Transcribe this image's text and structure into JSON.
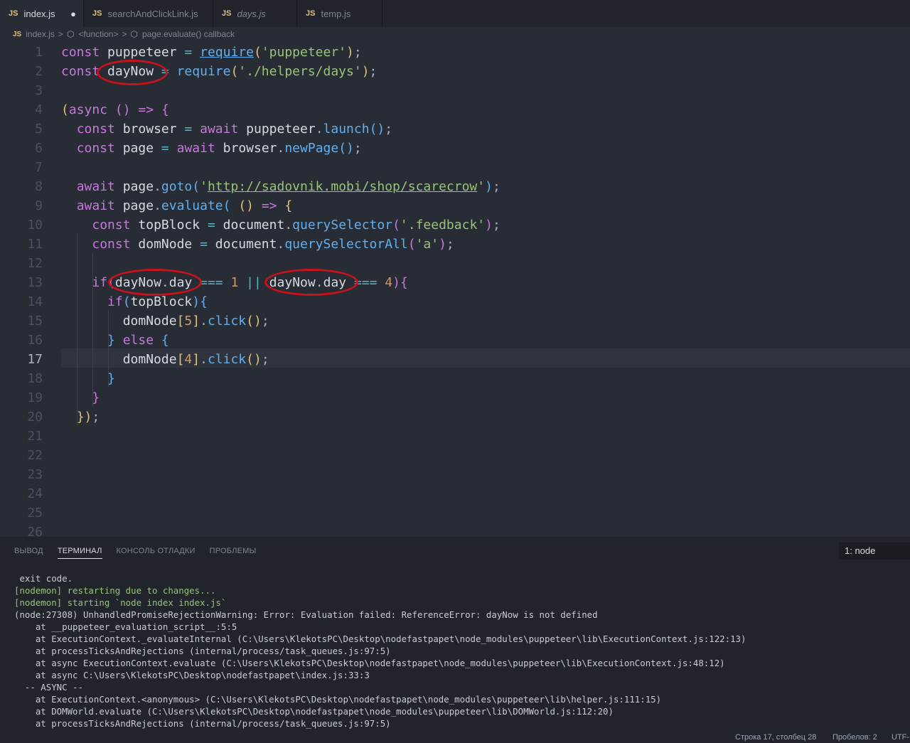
{
  "tabs": [
    {
      "label": "index.js",
      "badge": "JS",
      "modified": true
    },
    {
      "label": "searchAndClickLink.js",
      "badge": "JS"
    },
    {
      "label": "days.js",
      "badge": "JS",
      "italic": true
    },
    {
      "label": "temp.js",
      "badge": "JS"
    }
  ],
  "breadcrumb": {
    "file": "index.js",
    "badge": "JS",
    "fn": "<function>",
    "callback": "page.evaluate() callback",
    "separator": ">"
  },
  "editor": {
    "line_numbers": [
      "1",
      "2",
      "3",
      "4",
      "5",
      "6",
      "7",
      "8",
      "9",
      "10",
      "11",
      "12",
      "13",
      "14",
      "15",
      "16",
      "17",
      "18",
      "19",
      "20",
      "21",
      "22",
      "23",
      "24",
      "25",
      "26"
    ],
    "current_line": 17
  },
  "panel": {
    "tabs": [
      "ВЫВОД",
      "ТЕРМИНАЛ",
      "КОНСОЛЬ ОТЛАДКИ",
      "ПРОБЛЕМЫ"
    ],
    "active_tab": "ТЕРМИНАЛ",
    "terminal_select": "1: node",
    "terminal_lines": [
      " exit code.",
      "[nodemon] restarting due to changes...",
      "[nodemon] starting `node index index.js`",
      "(node:27308) UnhandledPromiseRejectionWarning: Error: Evaluation failed: ReferenceError: dayNow is not defined",
      "    at __puppeteer_evaluation_script__:5:5",
      "    at ExecutionContext._evaluateInternal (C:\\Users\\KlekotsPC\\Desktop\\nodefastpapet\\node_modules\\puppeteer\\lib\\ExecutionContext.js:122:13)",
      "    at processTicksAndRejections (internal/process/task_queues.js:97:5)",
      "    at async ExecutionContext.evaluate (C:\\Users\\KlekotsPC\\Desktop\\nodefastpapet\\node_modules\\puppeteer\\lib\\ExecutionContext.js:48:12)",
      "    at async C:\\Users\\KlekotsPC\\Desktop\\nodefastpapet\\index.js:33:3",
      "  -- ASYNC --",
      "    at ExecutionContext.<anonymous> (C:\\Users\\KlekotsPC\\Desktop\\nodefastpapet\\node_modules\\puppeteer\\lib\\helper.js:111:15)",
      "    at DOMWorld.evaluate (C:\\Users\\KlekotsPC\\Desktop\\nodefastpapet\\node_modules\\puppeteer\\lib\\DOMWorld.js:112:20)",
      "    at processTicksAndRejections (internal/process/task_queues.js:97:5)"
    ]
  },
  "status": {
    "position": "Строка 17, столбец 28",
    "spaces": "Пробелов: 2",
    "encoding": "UTF-"
  },
  "colors": {
    "annotation": "#c8131d",
    "editor_bg": "#282c34",
    "keyword": "#c678dd",
    "string": "#98c379",
    "function": "#61afef"
  },
  "icons": [
    "js-file-icon",
    "cube-icon"
  ]
}
